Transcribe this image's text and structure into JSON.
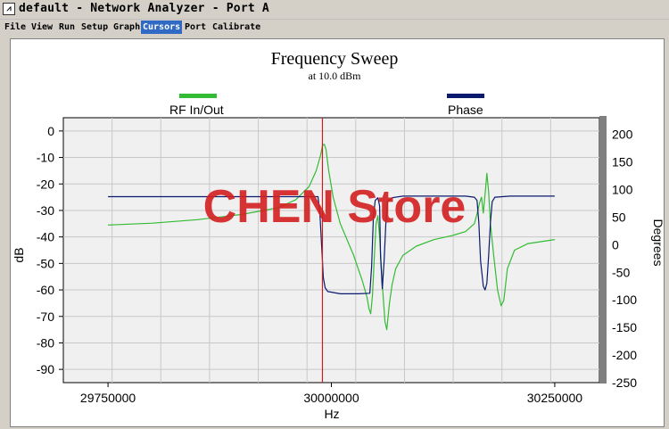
{
  "window": {
    "title": "default - Network Analyzer - Port A",
    "icon": "analyzer-icon"
  },
  "menu": [
    {
      "label": "File",
      "active": false
    },
    {
      "label": "View",
      "active": false
    },
    {
      "label": "Run",
      "active": false
    },
    {
      "label": "Setup",
      "active": false
    },
    {
      "label": "Graph",
      "active": false
    },
    {
      "label": "Cursors",
      "active": true
    },
    {
      "label": "Port",
      "active": false
    },
    {
      "label": "Calibrate",
      "active": false
    }
  ],
  "watermark": "CHEN Store",
  "colors": {
    "rf": "#33bb33",
    "phase": "#0a1a6e",
    "cursor": "#c81e1e",
    "watermark": "#d42020",
    "plot_bg": "#f0f0f0",
    "grid": "#c8c8c8"
  },
  "chart_data": {
    "type": "line",
    "title": "Frequency Sweep",
    "subtitle": "at 10.0 dBm",
    "xlabel": "Hz",
    "ylabel": "dB",
    "y2label": "Degrees",
    "xlim": [
      29700000,
      30300000
    ],
    "ylim": [
      -95,
      5
    ],
    "y2lim": [
      -250,
      230
    ],
    "x_ticks": [
      29750000,
      30000000,
      30250000
    ],
    "y_ticks": [
      0,
      -10,
      -20,
      -30,
      -40,
      -50,
      -60,
      -70,
      -80,
      -90
    ],
    "y2_ticks": [
      200,
      150,
      100,
      50,
      0,
      -50,
      -100,
      -150,
      -200,
      -250
    ],
    "grid": true,
    "cursor_x": 29990000,
    "legend_position": "top",
    "series": [
      {
        "name": "RF In/Out",
        "axis": "left",
        "points": [
          [
            29750000,
            -35.5
          ],
          [
            29800000,
            -34.8
          ],
          [
            29850000,
            -33.5
          ],
          [
            29900000,
            -31.5
          ],
          [
            29940000,
            -29
          ],
          [
            29960000,
            -26
          ],
          [
            29975000,
            -21
          ],
          [
            29983000,
            -15
          ],
          [
            29988000,
            -9
          ],
          [
            29990000,
            -5.5
          ],
          [
            29992000,
            -5
          ],
          [
            29994000,
            -7
          ],
          [
            29997000,
            -15
          ],
          [
            30002000,
            -25
          ],
          [
            30010000,
            -35
          ],
          [
            30025000,
            -47
          ],
          [
            30035000,
            -57
          ],
          [
            30040000,
            -63
          ],
          [
            30042000,
            -67
          ],
          [
            30044000,
            -69
          ],
          [
            30046000,
            -62
          ],
          [
            30048000,
            -48
          ],
          [
            30050000,
            -35
          ],
          [
            30052000,
            -32
          ],
          [
            30054000,
            -40
          ],
          [
            30057000,
            -58
          ],
          [
            30060000,
            -72
          ],
          [
            30062000,
            -75
          ],
          [
            30065000,
            -65
          ],
          [
            30068000,
            -58
          ],
          [
            30072000,
            -52
          ],
          [
            30080000,
            -47
          ],
          [
            30095000,
            -43.5
          ],
          [
            30115000,
            -41
          ],
          [
            30135000,
            -39.5
          ],
          [
            30150000,
            -38
          ],
          [
            30160000,
            -35
          ],
          [
            30164000,
            -30
          ],
          [
            30166000,
            -27
          ],
          [
            30168000,
            -25
          ],
          [
            30170000,
            -31
          ],
          [
            30172000,
            -24
          ],
          [
            30174000,
            -16
          ],
          [
            30176000,
            -23
          ],
          [
            30178000,
            -35
          ],
          [
            30182000,
            -48
          ],
          [
            30186000,
            -60
          ],
          [
            30190000,
            -66
          ],
          [
            30193000,
            -64
          ],
          [
            30197000,
            -52
          ],
          [
            30205000,
            -45
          ],
          [
            30220000,
            -42.5
          ],
          [
            30250000,
            -41
          ]
        ]
      },
      {
        "name": "Phase",
        "axis": "right",
        "points": [
          [
            29750000,
            87
          ],
          [
            29985000,
            87
          ],
          [
            29987000,
            60
          ],
          [
            29989000,
            0
          ],
          [
            29991000,
            -60
          ],
          [
            29993000,
            -78
          ],
          [
            29996000,
            -85
          ],
          [
            30010000,
            -89
          ],
          [
            30030000,
            -89
          ],
          [
            30043000,
            -88
          ],
          [
            30045000,
            -40
          ],
          [
            30047000,
            50
          ],
          [
            30049000,
            80
          ],
          [
            30052000,
            85
          ],
          [
            30054000,
            70
          ],
          [
            30055000,
            -20
          ],
          [
            30057000,
            -80
          ],
          [
            30059000,
            -30
          ],
          [
            30061000,
            40
          ],
          [
            30063000,
            78
          ],
          [
            30068000,
            85
          ],
          [
            30080000,
            88
          ],
          [
            30150000,
            88
          ],
          [
            30160000,
            86
          ],
          [
            30163000,
            80
          ],
          [
            30165000,
            40
          ],
          [
            30167000,
            -30
          ],
          [
            30170000,
            -75
          ],
          [
            30172000,
            -82
          ],
          [
            30174000,
            -70
          ],
          [
            30176000,
            -20
          ],
          [
            30178000,
            40
          ],
          [
            30180000,
            78
          ],
          [
            30183000,
            86
          ],
          [
            30200000,
            88
          ],
          [
            30250000,
            88
          ]
        ]
      }
    ]
  }
}
